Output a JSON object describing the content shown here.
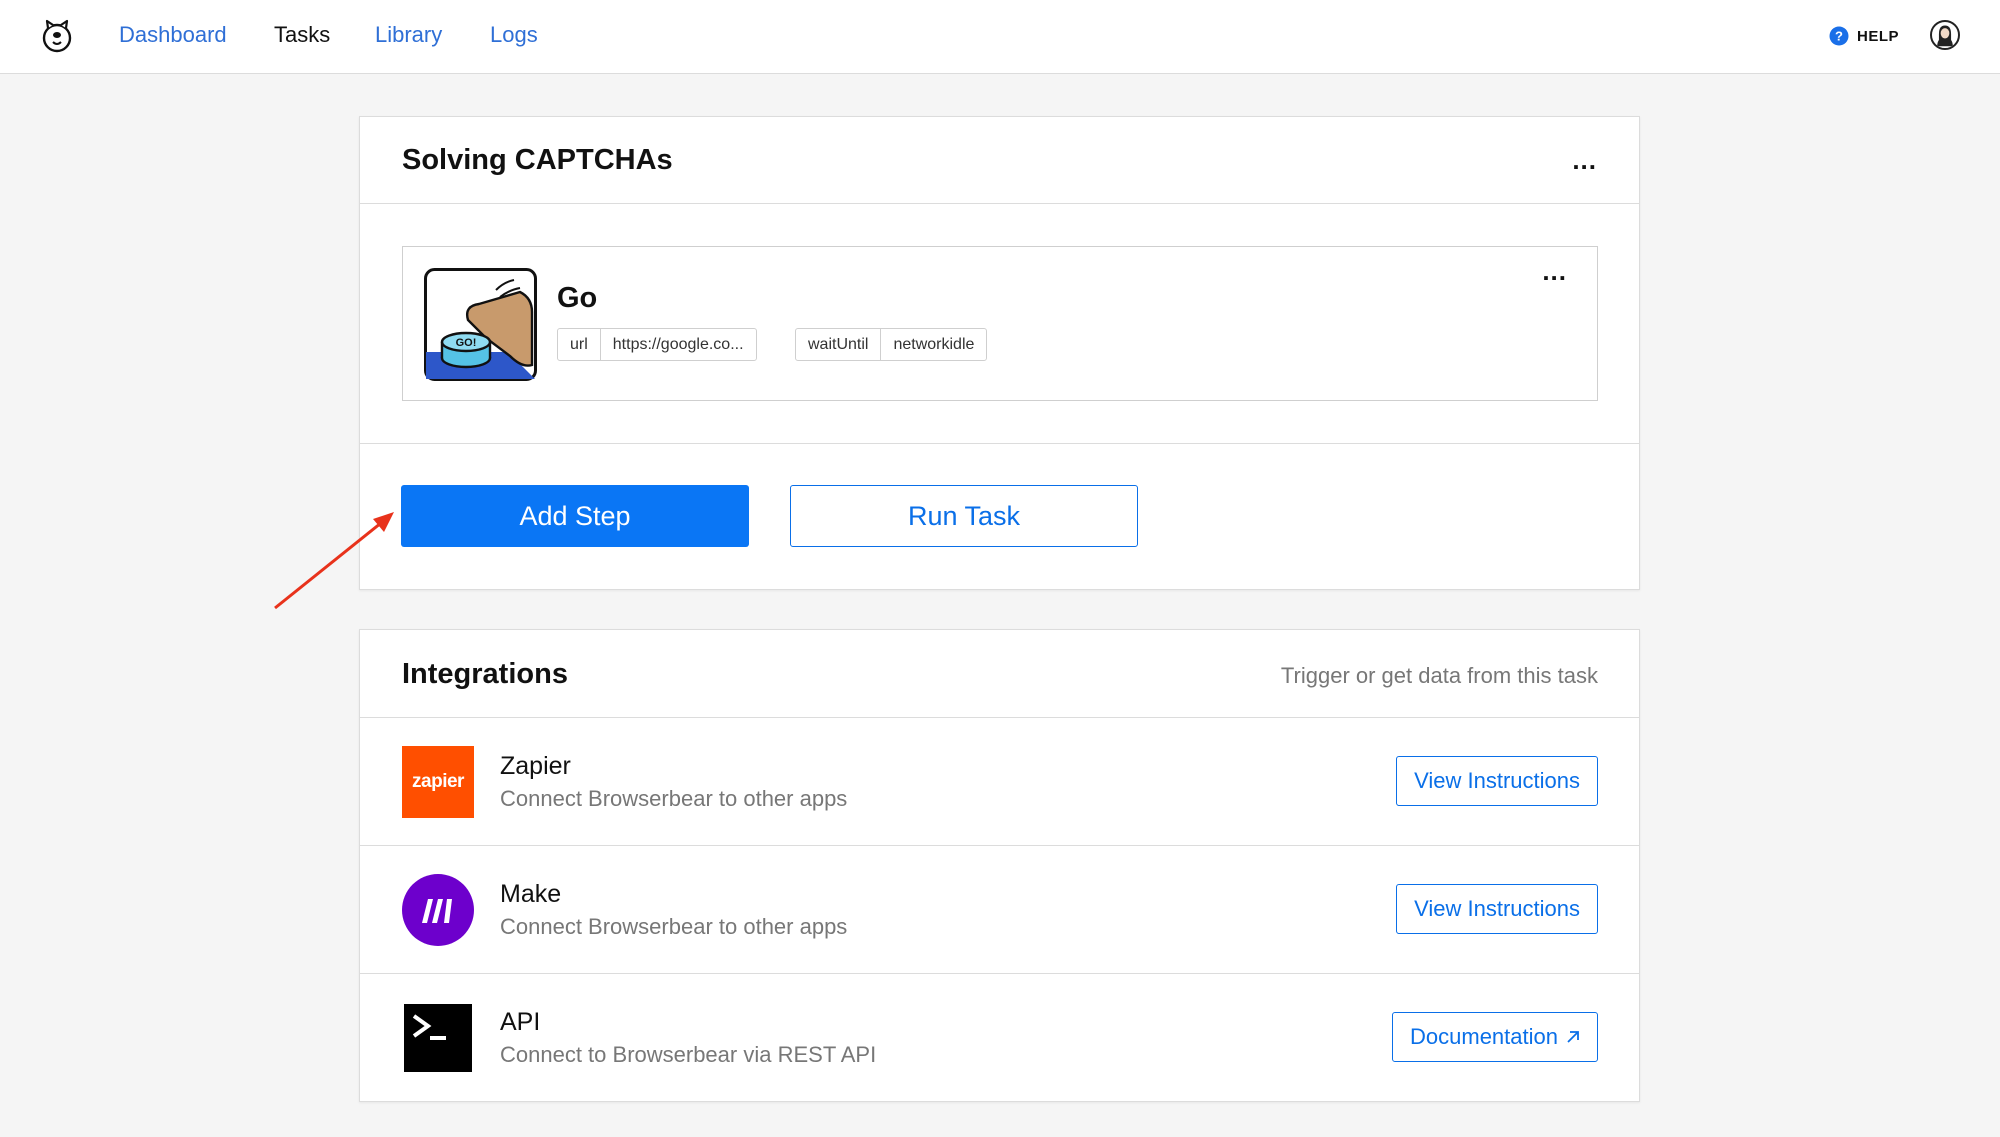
{
  "nav": {
    "items": [
      {
        "label": "Dashboard",
        "active": false
      },
      {
        "label": "Tasks",
        "active": true
      },
      {
        "label": "Library",
        "active": false
      },
      {
        "label": "Logs",
        "active": false
      }
    ],
    "help_label": "HELP",
    "help_icon": "question-circle-icon",
    "logo_icon": "bear-logo-icon",
    "avatar_icon": "user-avatar-icon"
  },
  "task": {
    "title": "Solving CAPTCHAs",
    "menu_label": "...",
    "step": {
      "title": "Go",
      "menu_label": "...",
      "thumbnail_icon": "go-button-illustration",
      "params": [
        {
          "key": "url",
          "value": "https://google.co..."
        },
        {
          "key": "waitUntil",
          "value": "networkidle"
        }
      ]
    },
    "add_step_label": "Add Step",
    "run_task_label": "Run Task"
  },
  "integrations": {
    "title": "Integrations",
    "subtitle": "Trigger or get data from this task",
    "items": [
      {
        "name": "Zapier",
        "description": "Connect Browserbear to other apps",
        "button": "View Instructions",
        "logo_text": "zapier",
        "logo_color": "#ff4f00"
      },
      {
        "name": "Make",
        "description": "Connect Browserbear to other apps",
        "button": "View Instructions",
        "logo_color": "#6d00cc"
      },
      {
        "name": "API",
        "description": "Connect to Browserbear via REST API",
        "button": "Documentation",
        "button_icon": "external-link-icon"
      }
    ]
  },
  "colors": {
    "primary": "#0a76f5",
    "link": "#2f6fd6",
    "annotation_arrow": "#e8321b"
  }
}
